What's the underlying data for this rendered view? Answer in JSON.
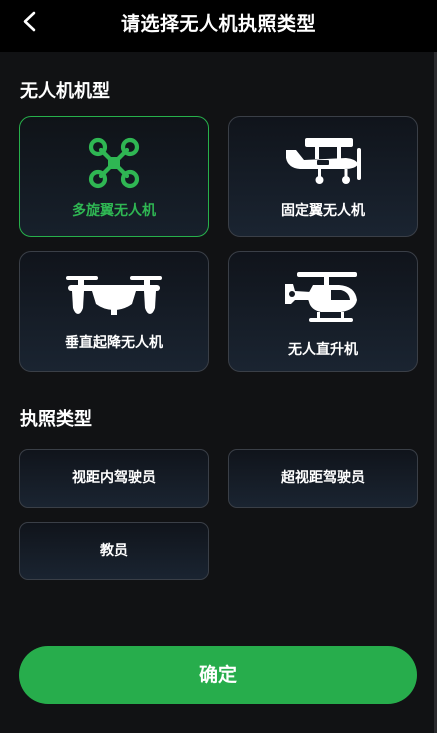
{
  "header": {
    "title": "请选择无人机执照类型",
    "back_icon": "chevron-left-icon"
  },
  "drone_section": {
    "title": "无人机机型",
    "selected_index": 0,
    "items": [
      {
        "label": "多旋翼无人机",
        "icon": "multirotor-drone-icon"
      },
      {
        "label": "固定翼无人机",
        "icon": "fixed-wing-plane-icon"
      },
      {
        "label": "垂直起降无人机",
        "icon": "vtol-drone-icon"
      },
      {
        "label": "无人直升机",
        "icon": "helicopter-icon"
      }
    ]
  },
  "license_section": {
    "title": "执照类型",
    "items": [
      {
        "label": "视距内驾驶员"
      },
      {
        "label": "超视距驾驶员"
      },
      {
        "label": "教员"
      }
    ]
  },
  "confirm_label": "确定",
  "colors": {
    "accent": "#27ad4c",
    "background": "#111214",
    "header": "#000000"
  }
}
